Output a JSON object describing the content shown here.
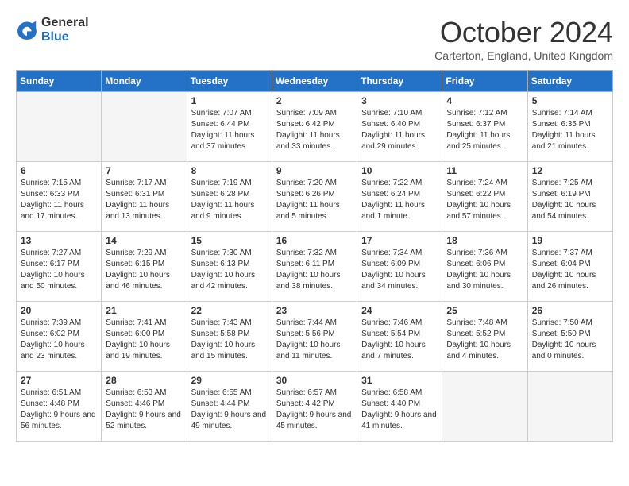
{
  "logo": {
    "text_general": "General",
    "text_blue": "Blue"
  },
  "header": {
    "month": "October 2024",
    "location": "Carterton, England, United Kingdom"
  },
  "days_of_week": [
    "Sunday",
    "Monday",
    "Tuesday",
    "Wednesday",
    "Thursday",
    "Friday",
    "Saturday"
  ],
  "weeks": [
    [
      {
        "day": "",
        "empty": true
      },
      {
        "day": "",
        "empty": true
      },
      {
        "day": "1",
        "sunrise": "Sunrise: 7:07 AM",
        "sunset": "Sunset: 6:44 PM",
        "daylight": "Daylight: 11 hours and 37 minutes."
      },
      {
        "day": "2",
        "sunrise": "Sunrise: 7:09 AM",
        "sunset": "Sunset: 6:42 PM",
        "daylight": "Daylight: 11 hours and 33 minutes."
      },
      {
        "day": "3",
        "sunrise": "Sunrise: 7:10 AM",
        "sunset": "Sunset: 6:40 PM",
        "daylight": "Daylight: 11 hours and 29 minutes."
      },
      {
        "day": "4",
        "sunrise": "Sunrise: 7:12 AM",
        "sunset": "Sunset: 6:37 PM",
        "daylight": "Daylight: 11 hours and 25 minutes."
      },
      {
        "day": "5",
        "sunrise": "Sunrise: 7:14 AM",
        "sunset": "Sunset: 6:35 PM",
        "daylight": "Daylight: 11 hours and 21 minutes."
      }
    ],
    [
      {
        "day": "6",
        "sunrise": "Sunrise: 7:15 AM",
        "sunset": "Sunset: 6:33 PM",
        "daylight": "Daylight: 11 hours and 17 minutes."
      },
      {
        "day": "7",
        "sunrise": "Sunrise: 7:17 AM",
        "sunset": "Sunset: 6:31 PM",
        "daylight": "Daylight: 11 hours and 13 minutes."
      },
      {
        "day": "8",
        "sunrise": "Sunrise: 7:19 AM",
        "sunset": "Sunset: 6:28 PM",
        "daylight": "Daylight: 11 hours and 9 minutes."
      },
      {
        "day": "9",
        "sunrise": "Sunrise: 7:20 AM",
        "sunset": "Sunset: 6:26 PM",
        "daylight": "Daylight: 11 hours and 5 minutes."
      },
      {
        "day": "10",
        "sunrise": "Sunrise: 7:22 AM",
        "sunset": "Sunset: 6:24 PM",
        "daylight": "Daylight: 11 hours and 1 minute."
      },
      {
        "day": "11",
        "sunrise": "Sunrise: 7:24 AM",
        "sunset": "Sunset: 6:22 PM",
        "daylight": "Daylight: 10 hours and 57 minutes."
      },
      {
        "day": "12",
        "sunrise": "Sunrise: 7:25 AM",
        "sunset": "Sunset: 6:19 PM",
        "daylight": "Daylight: 10 hours and 54 minutes."
      }
    ],
    [
      {
        "day": "13",
        "sunrise": "Sunrise: 7:27 AM",
        "sunset": "Sunset: 6:17 PM",
        "daylight": "Daylight: 10 hours and 50 minutes."
      },
      {
        "day": "14",
        "sunrise": "Sunrise: 7:29 AM",
        "sunset": "Sunset: 6:15 PM",
        "daylight": "Daylight: 10 hours and 46 minutes."
      },
      {
        "day": "15",
        "sunrise": "Sunrise: 7:30 AM",
        "sunset": "Sunset: 6:13 PM",
        "daylight": "Daylight: 10 hours and 42 minutes."
      },
      {
        "day": "16",
        "sunrise": "Sunrise: 7:32 AM",
        "sunset": "Sunset: 6:11 PM",
        "daylight": "Daylight: 10 hours and 38 minutes."
      },
      {
        "day": "17",
        "sunrise": "Sunrise: 7:34 AM",
        "sunset": "Sunset: 6:09 PM",
        "daylight": "Daylight: 10 hours and 34 minutes."
      },
      {
        "day": "18",
        "sunrise": "Sunrise: 7:36 AM",
        "sunset": "Sunset: 6:06 PM",
        "daylight": "Daylight: 10 hours and 30 minutes."
      },
      {
        "day": "19",
        "sunrise": "Sunrise: 7:37 AM",
        "sunset": "Sunset: 6:04 PM",
        "daylight": "Daylight: 10 hours and 26 minutes."
      }
    ],
    [
      {
        "day": "20",
        "sunrise": "Sunrise: 7:39 AM",
        "sunset": "Sunset: 6:02 PM",
        "daylight": "Daylight: 10 hours and 23 minutes."
      },
      {
        "day": "21",
        "sunrise": "Sunrise: 7:41 AM",
        "sunset": "Sunset: 6:00 PM",
        "daylight": "Daylight: 10 hours and 19 minutes."
      },
      {
        "day": "22",
        "sunrise": "Sunrise: 7:43 AM",
        "sunset": "Sunset: 5:58 PM",
        "daylight": "Daylight: 10 hours and 15 minutes."
      },
      {
        "day": "23",
        "sunrise": "Sunrise: 7:44 AM",
        "sunset": "Sunset: 5:56 PM",
        "daylight": "Daylight: 10 hours and 11 minutes."
      },
      {
        "day": "24",
        "sunrise": "Sunrise: 7:46 AM",
        "sunset": "Sunset: 5:54 PM",
        "daylight": "Daylight: 10 hours and 7 minutes."
      },
      {
        "day": "25",
        "sunrise": "Sunrise: 7:48 AM",
        "sunset": "Sunset: 5:52 PM",
        "daylight": "Daylight: 10 hours and 4 minutes."
      },
      {
        "day": "26",
        "sunrise": "Sunrise: 7:50 AM",
        "sunset": "Sunset: 5:50 PM",
        "daylight": "Daylight: 10 hours and 0 minutes."
      }
    ],
    [
      {
        "day": "27",
        "sunrise": "Sunrise: 6:51 AM",
        "sunset": "Sunset: 4:48 PM",
        "daylight": "Daylight: 9 hours and 56 minutes."
      },
      {
        "day": "28",
        "sunrise": "Sunrise: 6:53 AM",
        "sunset": "Sunset: 4:46 PM",
        "daylight": "Daylight: 9 hours and 52 minutes."
      },
      {
        "day": "29",
        "sunrise": "Sunrise: 6:55 AM",
        "sunset": "Sunset: 4:44 PM",
        "daylight": "Daylight: 9 hours and 49 minutes."
      },
      {
        "day": "30",
        "sunrise": "Sunrise: 6:57 AM",
        "sunset": "Sunset: 4:42 PM",
        "daylight": "Daylight: 9 hours and 45 minutes."
      },
      {
        "day": "31",
        "sunrise": "Sunrise: 6:58 AM",
        "sunset": "Sunset: 4:40 PM",
        "daylight": "Daylight: 9 hours and 41 minutes."
      },
      {
        "day": "",
        "empty": true
      },
      {
        "day": "",
        "empty": true
      }
    ]
  ]
}
